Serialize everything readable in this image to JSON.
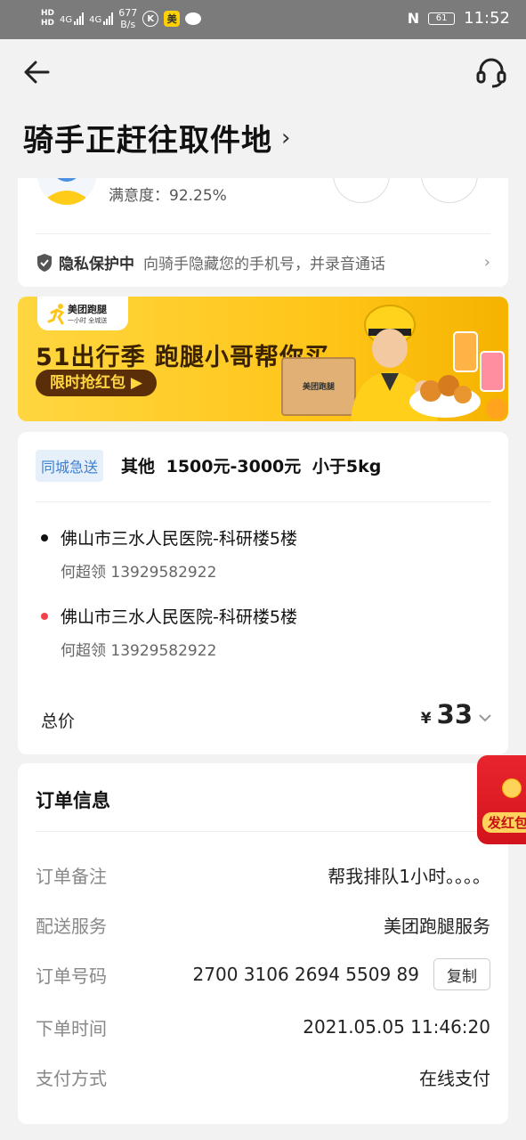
{
  "status_bar": {
    "hd_top": "HD",
    "hd_bottom": "HD",
    "net1": "4G",
    "net2": "4G",
    "speed_value": "677",
    "speed_unit": "B/s",
    "app_icon_k": "K",
    "app_icon_mei": "美",
    "battery": "61",
    "time": "11:52"
  },
  "header": {
    "back_icon": "arrow-left-icon",
    "support_icon": "headset-icon"
  },
  "page": {
    "title": "骑手正赶往取件地",
    "title_chevron": "›"
  },
  "rider": {
    "satisfaction": "满意度：92.25%",
    "privacy_title": "隐私保护中",
    "privacy_desc": "向骑手隐藏您的手机号，并录音通话",
    "privacy_chevron": "›"
  },
  "banner": {
    "logo_text": "美团跑腿",
    "logo_sub": "一小时 全城送",
    "headline": "51出行季 跑腿小哥帮你买",
    "button": "限时抢红包 ▶",
    "box_text": "美团跑腿"
  },
  "order": {
    "service_tag": "同城急送",
    "summary": "其他  1500元-3000元  小于5kg",
    "pickup": {
      "address": "佛山市三水人民医院-科研楼5楼",
      "contact": "何超领 13929582922",
      "dot_color": "#111111"
    },
    "dropoff": {
      "address": "佛山市三水人民医院-科研楼5楼",
      "contact": "何超领 13929582922",
      "dot_color": "#f0424a"
    },
    "total_label": "总价",
    "currency": "¥",
    "total_amount": "33",
    "total_chevron": "⌄"
  },
  "order_info": {
    "title": "订单信息",
    "rows": [
      {
        "label": "订单备注",
        "value": "帮我排队1小时。。。。"
      },
      {
        "label": "配送服务",
        "value": "美团跑腿服务"
      },
      {
        "label": "订单号码",
        "value": "2700 3106 2694 5509 89"
      },
      {
        "label": "下单时间",
        "value": "2021.05.05 11:46:20"
      },
      {
        "label": "支付方式",
        "value": "在线支付"
      }
    ],
    "copy_label": "复制"
  },
  "floating_red_packet": {
    "label": "发红包"
  },
  "colors": {
    "accent_yellow": "#ffc61a",
    "tag_blue": "#3d7fd1",
    "red": "#e8252e"
  }
}
